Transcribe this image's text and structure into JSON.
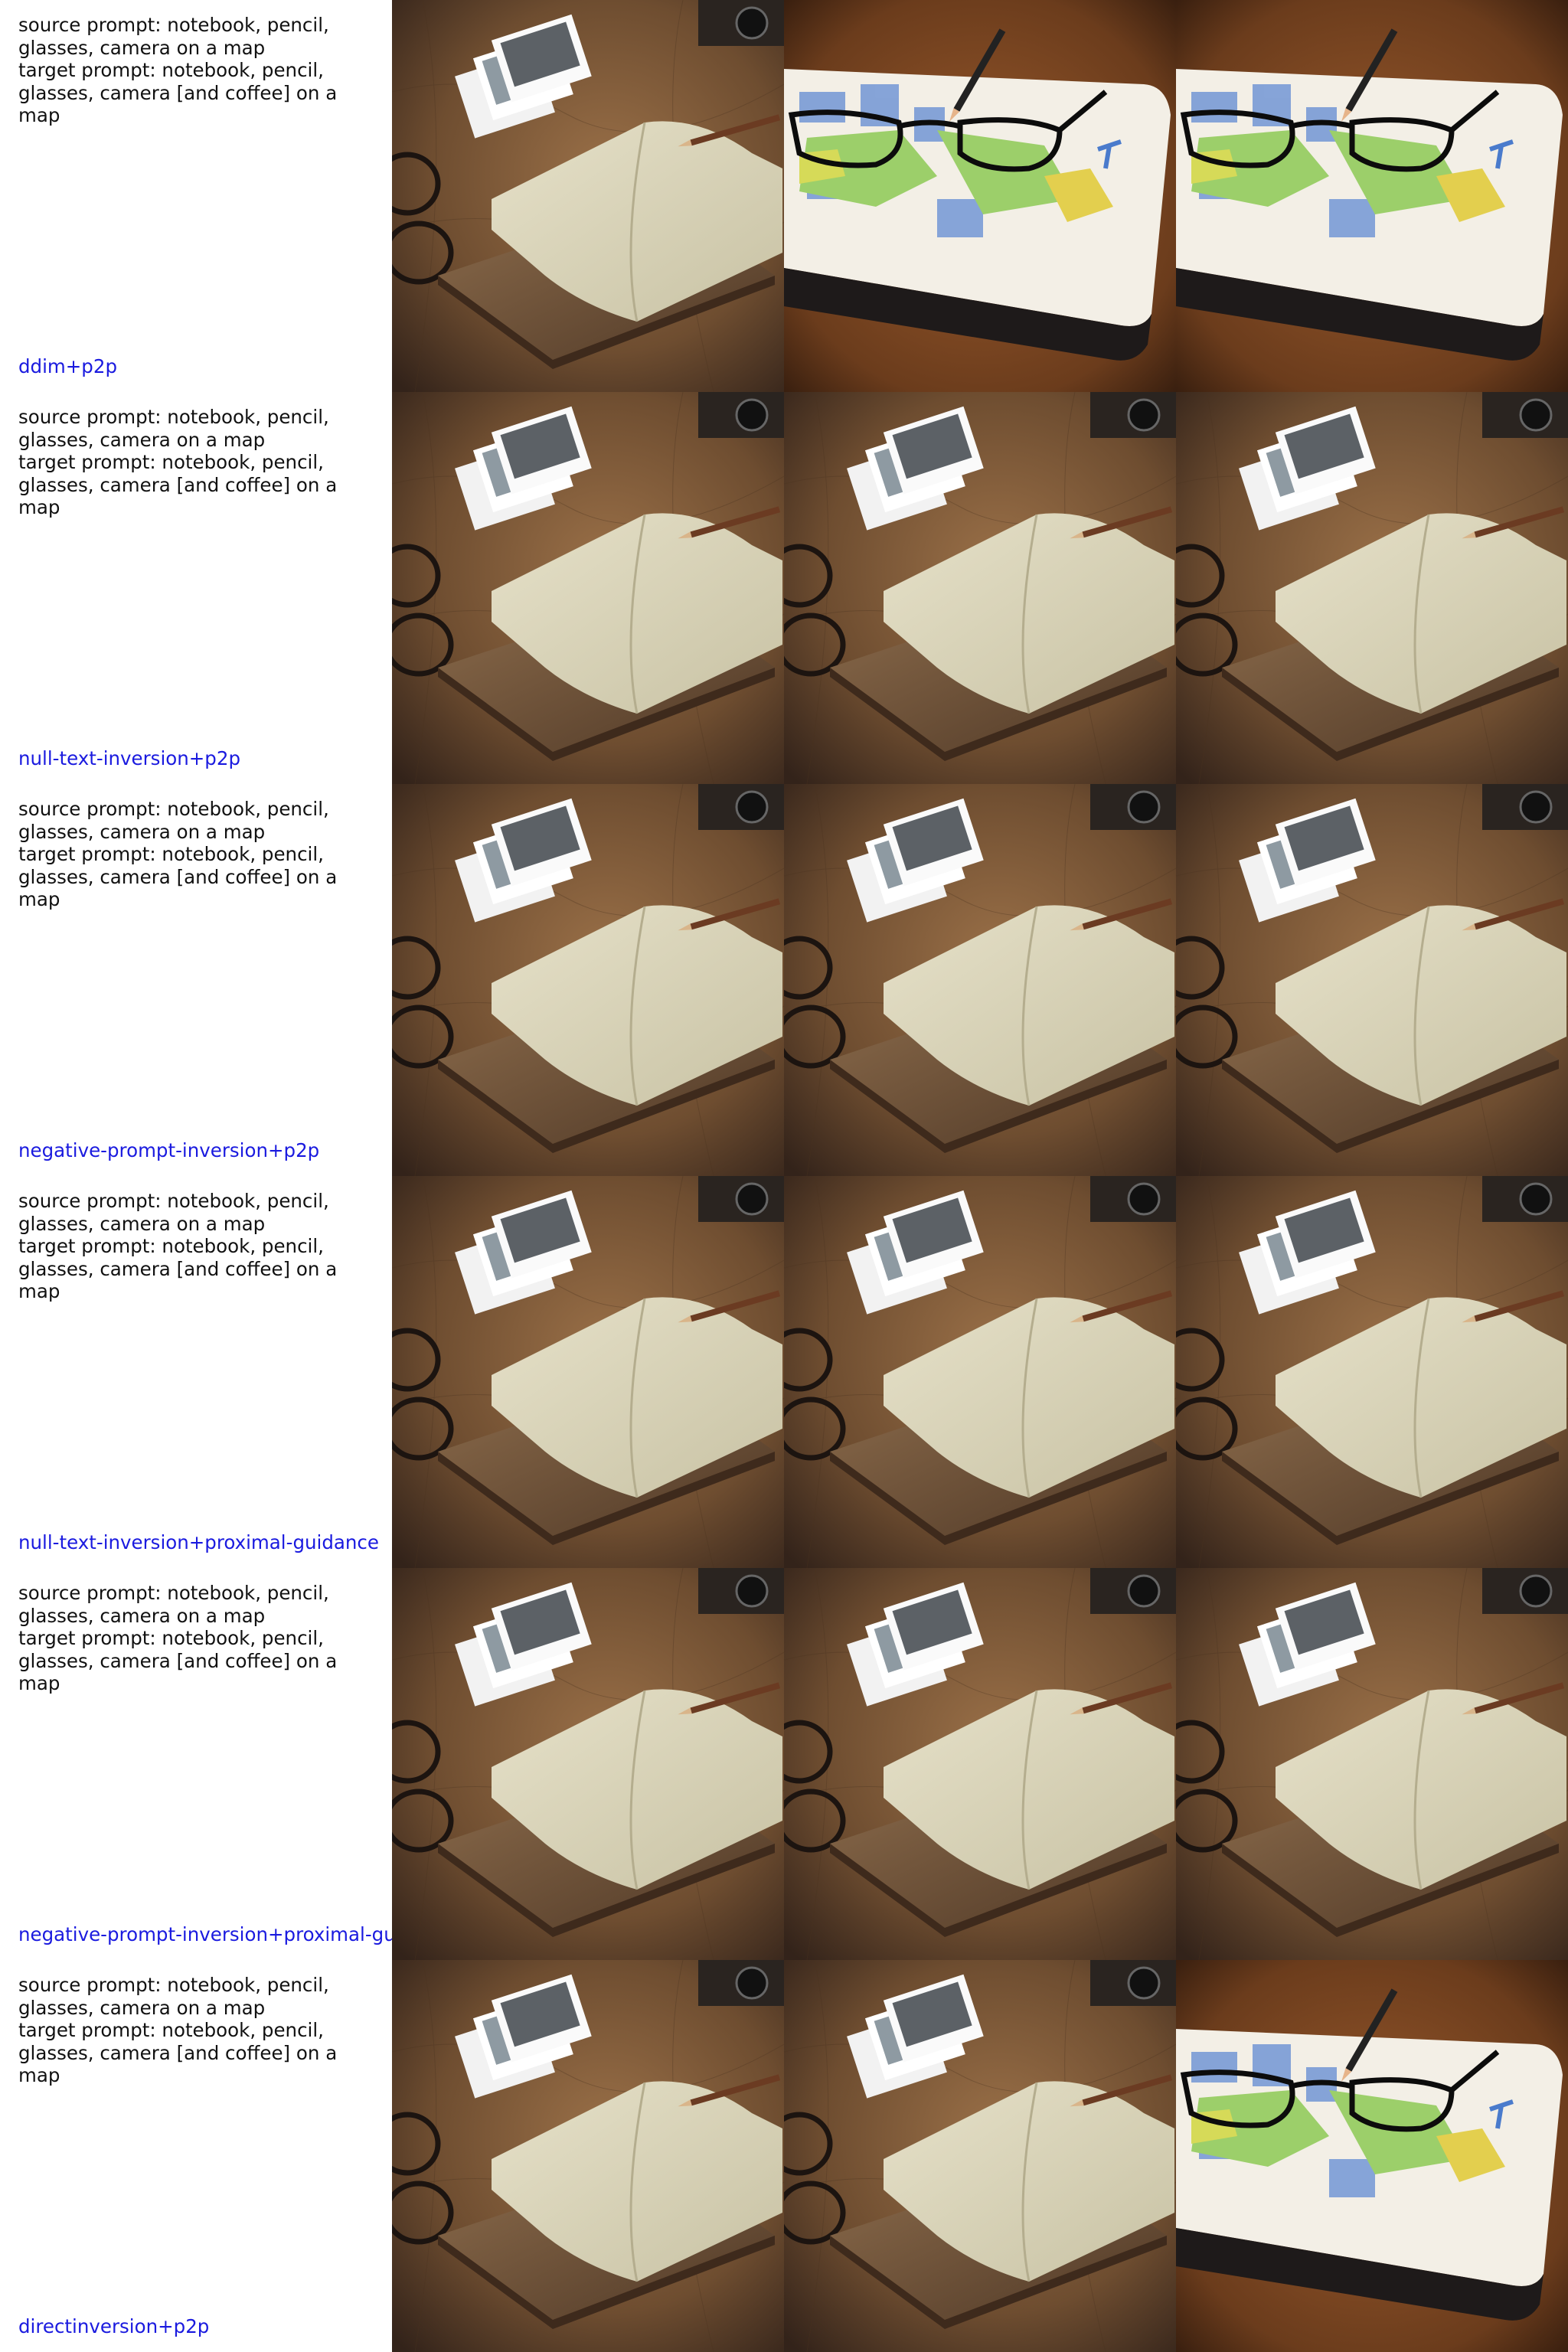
{
  "rows": [
    {
      "source_prompt": "source prompt: notebook, pencil, glasses, camera on a map",
      "target_prompt": "target prompt: notebook, pencil, glasses, camera [and coffee] on a map",
      "method": "ddim+p2p",
      "cells": [
        "notebook-photo",
        "map-notebook-photo",
        "map-notebook-photo"
      ]
    },
    {
      "source_prompt": "source prompt: notebook, pencil, glasses, camera on a map",
      "target_prompt": "target prompt: notebook, pencil, glasses, camera [and coffee] on a map",
      "method": "null-text-inversion+p2p",
      "cells": [
        "notebook-photo",
        "notebook-photo",
        "notebook-photo"
      ]
    },
    {
      "source_prompt": "source prompt: notebook, pencil, glasses, camera on a map",
      "target_prompt": "target prompt: notebook, pencil, glasses, camera [and coffee] on a map",
      "method": "negative-prompt-inversion+p2p",
      "cells": [
        "notebook-photo",
        "notebook-photo",
        "notebook-photo"
      ]
    },
    {
      "source_prompt": "source prompt: notebook, pencil, glasses, camera on a map",
      "target_prompt": "target prompt: notebook, pencil, glasses, camera [and coffee] on a map",
      "method": "null-text-inversion+proximal-guidance",
      "cells": [
        "notebook-photo",
        "notebook-photo",
        "notebook-photo"
      ]
    },
    {
      "source_prompt": "source prompt: notebook, pencil, glasses, camera on a map",
      "target_prompt": "target prompt: notebook, pencil, glasses, camera [and coffee] on a map",
      "method": "negative-prompt-inversion+proximal-guidance",
      "cells": [
        "notebook-photo",
        "notebook-photo",
        "notebook-photo"
      ]
    },
    {
      "source_prompt": "source prompt: notebook, pencil, glasses, camera on a map",
      "target_prompt": "target prompt: notebook, pencil, glasses, camera [and coffee] on a map",
      "method": "directinversion+p2p",
      "cells": [
        "notebook-photo",
        "notebook-photo",
        "map-notebook-photo"
      ]
    }
  ]
}
